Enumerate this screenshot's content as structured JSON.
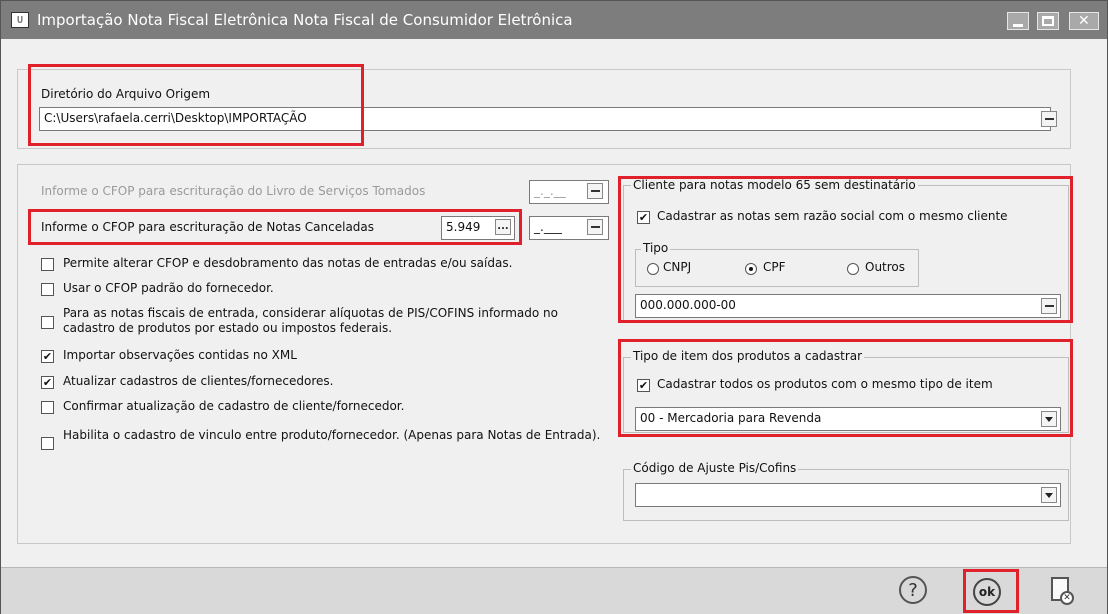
{
  "window": {
    "app_icon": "U",
    "title": "Importação Nota Fiscal Eletrônica Nota Fiscal de Consumidor Eletrônica",
    "minimize_icon": "minimize-icon",
    "maximize_icon": "maximize-icon",
    "close_icon": "close-icon"
  },
  "source_dir": {
    "label": "Diretório do Arquivo Origem",
    "value": "C:\\Users\\rafaela.cerri\\Desktop\\IMPORTAÇÃO"
  },
  "cfop": {
    "services_label": "Informe o CFOP para escrituração do Livro de Serviços Tomados",
    "services_value": "_._.__",
    "canceled_label": "Informe o CFOP para escrituração de Notas Canceladas",
    "canceled_value": "5.949",
    "canceled_extra": "_.___",
    "ellipsis": "..."
  },
  "options": [
    {
      "text": "Permite alterar CFOP e desdobramento das notas de entradas e/ou saídas.",
      "checked": false
    },
    {
      "text": "Usar o CFOP padrão do fornecedor.",
      "checked": false
    },
    {
      "text": "Para as notas fiscais de entrada, considerar alíquotas de PIS/COFINS informado no cadastro de produtos por estado ou impostos federais.",
      "checked": false
    },
    {
      "text": "Importar observações contidas no XML",
      "checked": true
    },
    {
      "text": "Atualizar cadastros de clientes/fornecedores.",
      "checked": true
    },
    {
      "text": "Confirmar atualização de cadastro de cliente/fornecedor.",
      "checked": false
    },
    {
      "text": "Habilita o cadastro de vinculo entre produto/fornecedor.  (Apenas para Notas de Entrada).",
      "checked": false
    }
  ],
  "client65": {
    "legend": "Cliente para notas modelo 65 sem destinatário",
    "same_client_label": "Cadastrar as notas sem razão social com o mesmo cliente",
    "same_client_checked": true,
    "tipo_legend": "Tipo",
    "radio_cnpj": "CNPJ",
    "radio_cpf": "CPF",
    "radio_outros": "Outros",
    "selected": "CPF",
    "doc_value": "000.000.000-00"
  },
  "item_type": {
    "legend": "Tipo de item dos produtos a cadastrar",
    "same_type_label": "Cadastrar todos os produtos com o mesmo tipo de item",
    "same_type_checked": true,
    "selected": "00 - Mercadoria para Revenda"
  },
  "pis_cofins": {
    "legend": "Código de Ajuste Pis/Cofins",
    "selected": ""
  },
  "footer": {
    "help": "?",
    "ok": "ok"
  },
  "check_mark": "✔"
}
